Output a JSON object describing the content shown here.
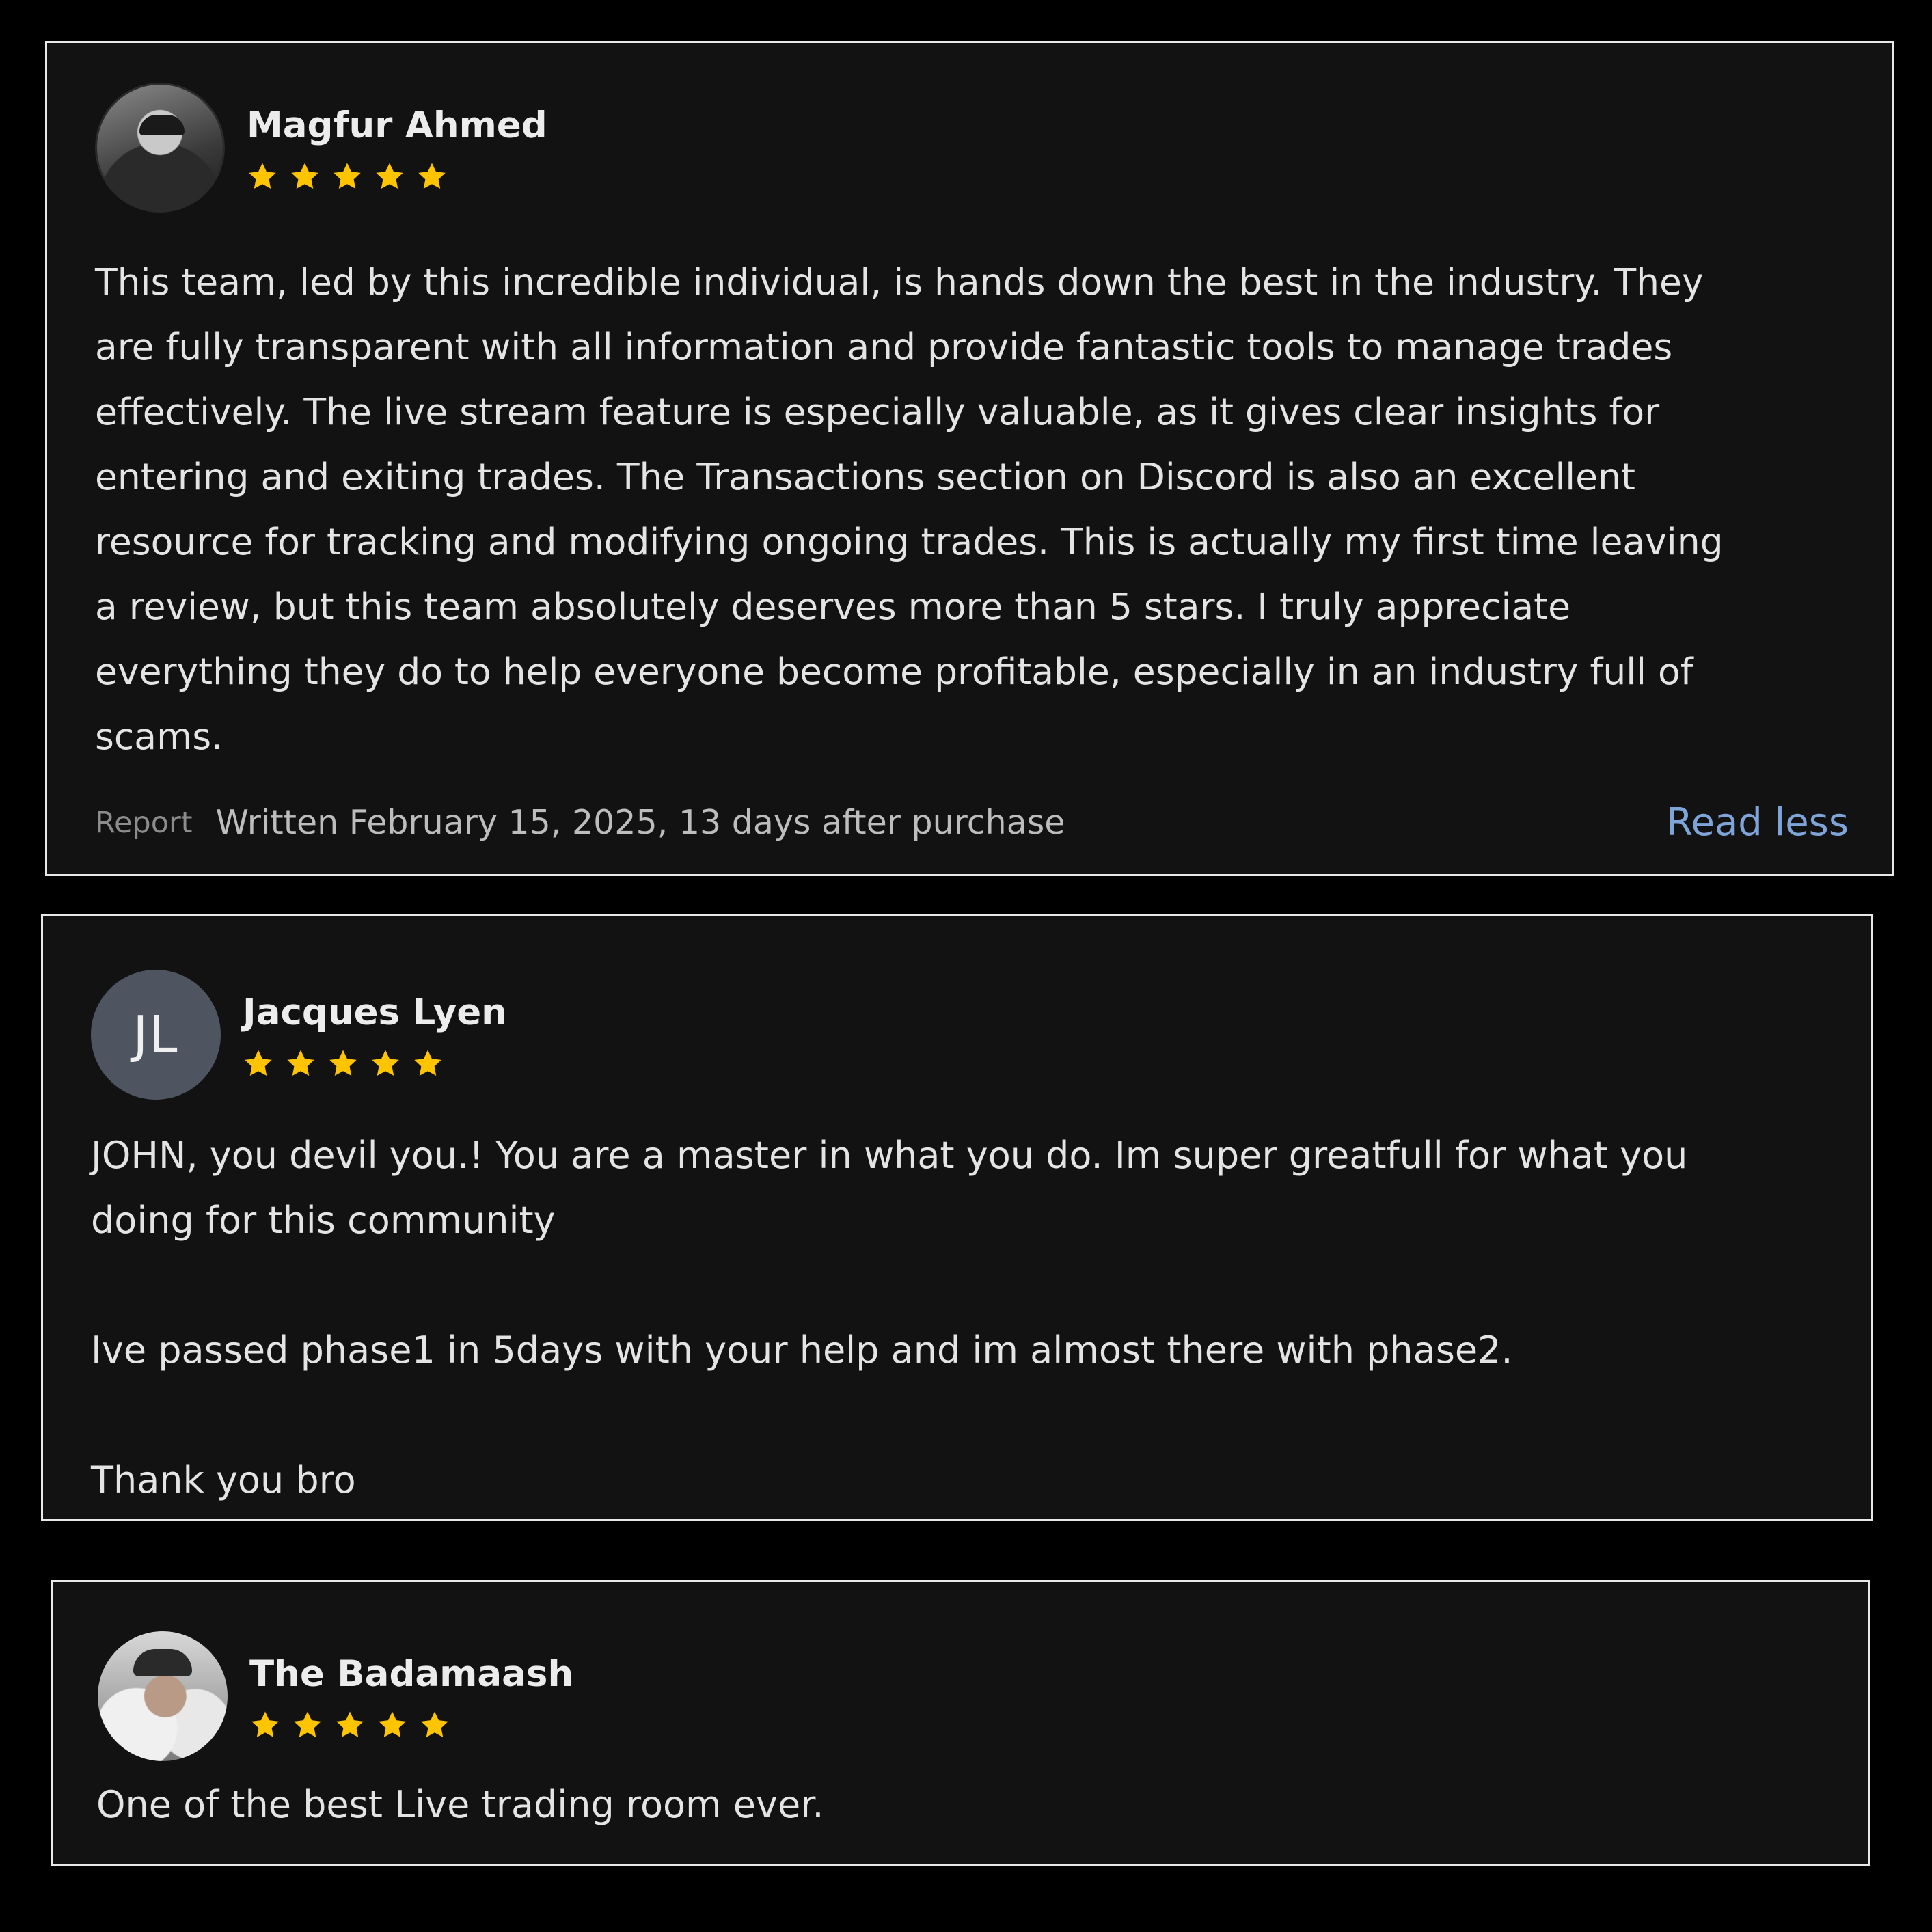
{
  "reviews": [
    {
      "name": "Magfur Ahmed",
      "avatar": "profile-photo",
      "rating": 5,
      "body": "This team, led by this incredible individual, is hands down the best in the industry. They\nare fully transparent with all information and provide fantastic tools to manage trades\neffectively. The live stream feature is especially valuable, as it gives clear insights for\nentering and exiting trades. The Transactions section on Discord is also an excellent\nresource for tracking and modifying ongoing trades. This is actually my first time leaving\na review, but this team absolutely deserves more than 5 stars. I truly appreciate\neverything they do to help everyone become profitable, especially in an industry full of\nscams.",
      "report_label": "Report",
      "written": "Written February 15, 2025, 13 days after purchase",
      "toggle_label": "Read less"
    },
    {
      "name": "Jacques Lyen",
      "avatar_initials": "JL",
      "rating": 5,
      "body": "JOHN, you devil you.! You are a master in what you do. Im super greatfull for what you\ndoing for this community\n\nIve passed phase1 in 5days with your help and im almost there with phase2.\n\nThank you bro"
    },
    {
      "name": "The Badamaash",
      "avatar": "profile-photo",
      "rating": 5,
      "body": "One of the best Live trading room ever."
    }
  ],
  "colors": {
    "page_background": "#000000",
    "card_background": "#121212",
    "card_border": "#e8e8e8",
    "star": "#ffc400",
    "link": "#7fa4d8",
    "initials_avatar": "#4e5560"
  },
  "icons": {
    "star": "star-icon"
  }
}
